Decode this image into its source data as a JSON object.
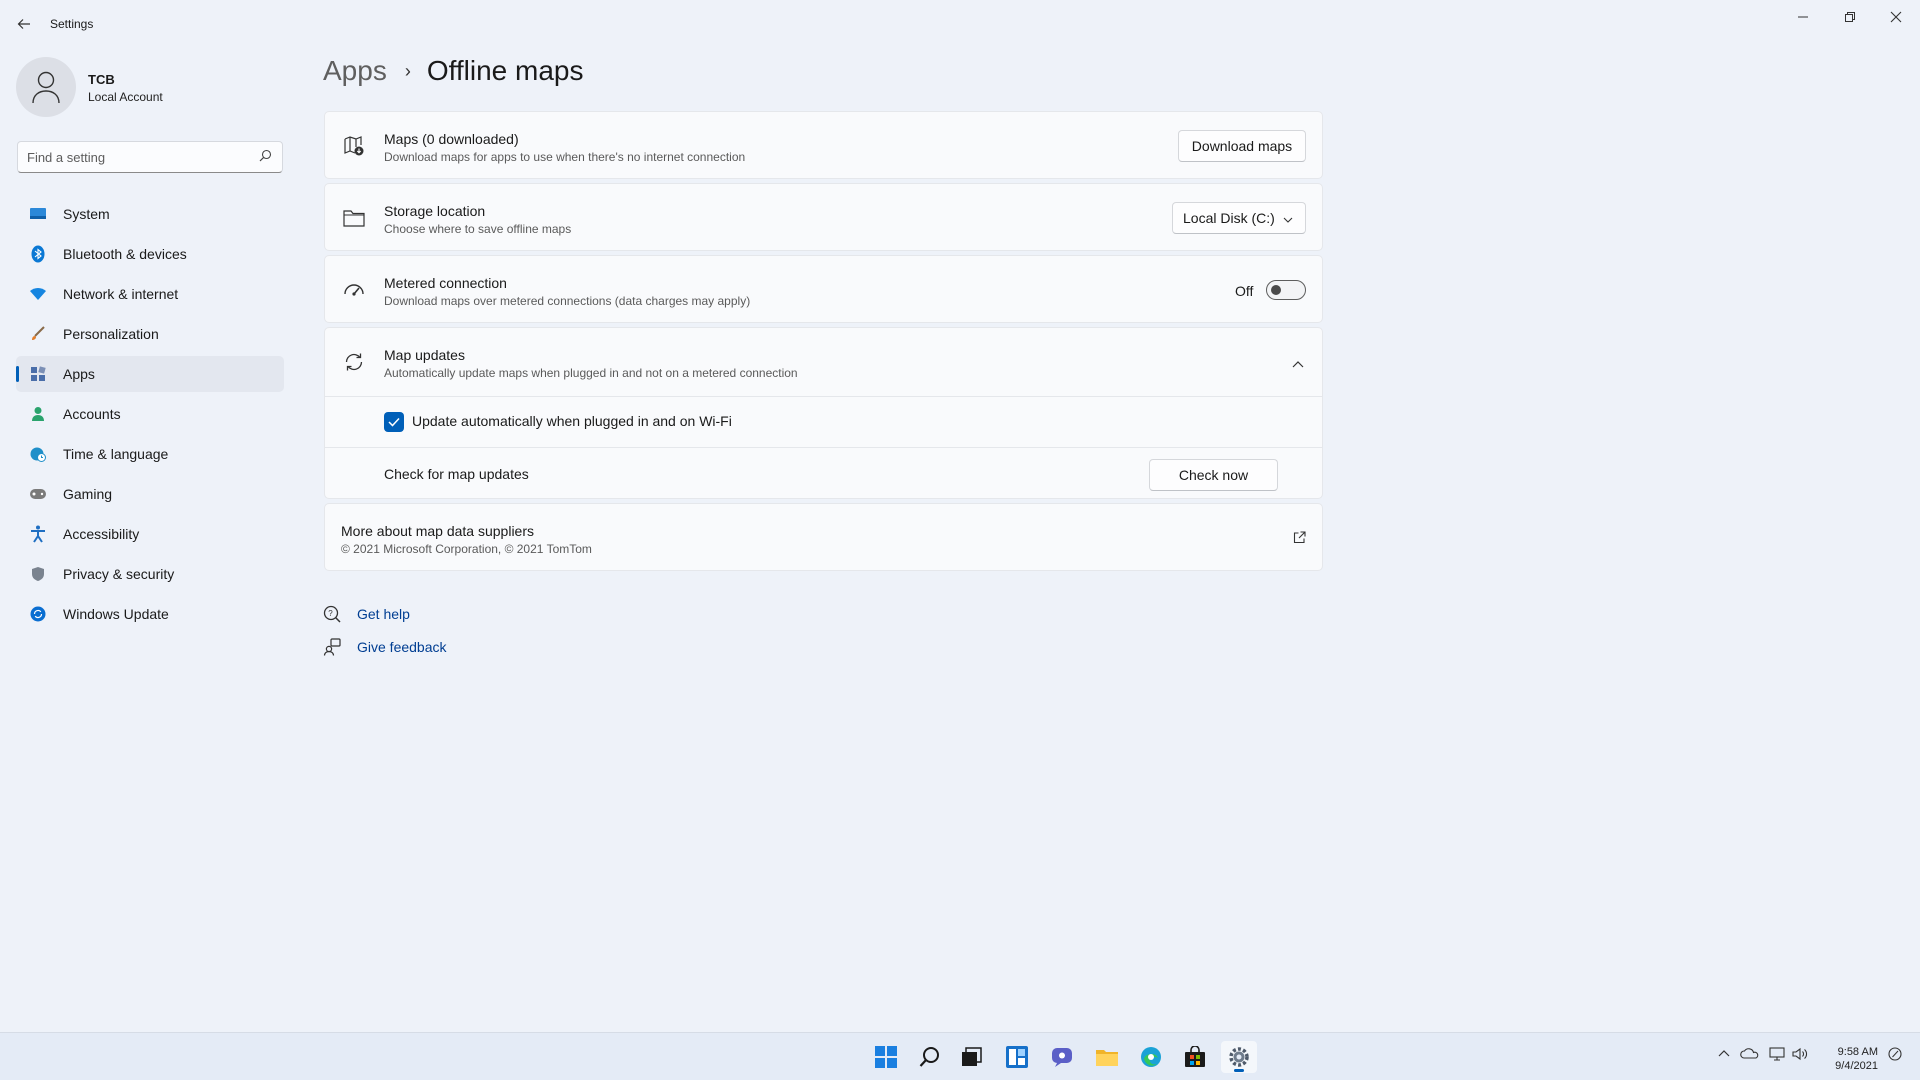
{
  "window": {
    "title": "Settings",
    "back_icon": "back-arrow-icon",
    "controls": [
      "minimize",
      "restore",
      "close"
    ]
  },
  "profile": {
    "name": "TCB",
    "account_type": "Local Account"
  },
  "search": {
    "placeholder": "Find a setting"
  },
  "sidebar": {
    "items": [
      {
        "label": "System",
        "icon": "system-icon",
        "color": "#0078d4"
      },
      {
        "label": "Bluetooth & devices",
        "icon": "bluetooth-icon",
        "color": "#0078d4"
      },
      {
        "label": "Network & internet",
        "icon": "wifi-icon",
        "color": "#0078d4"
      },
      {
        "label": "Personalization",
        "icon": "brush-icon",
        "color": "#e37e2b"
      },
      {
        "label": "Apps",
        "icon": "apps-icon",
        "color": "#4a6ea9"
      },
      {
        "label": "Accounts",
        "icon": "person-icon",
        "color": "#2aa36d"
      },
      {
        "label": "Time & language",
        "icon": "globe-clock-icon",
        "color": "#1f8fc9"
      },
      {
        "label": "Gaming",
        "icon": "gamepad-icon",
        "color": "#6b6b6b"
      },
      {
        "label": "Accessibility",
        "icon": "accessibility-icon",
        "color": "#1f6fc2"
      },
      {
        "label": "Privacy & security",
        "icon": "shield-icon",
        "color": "#707a86"
      },
      {
        "label": "Windows Update",
        "icon": "update-icon",
        "color": "#0a6ed1"
      }
    ],
    "active_index": 4
  },
  "breadcrumb": {
    "parent": "Apps",
    "separator": "›",
    "current": "Offline maps"
  },
  "cards": {
    "maps": {
      "title": "Maps (0 downloaded)",
      "subtitle": "Download maps for apps to use when there's no internet connection",
      "button": "Download maps"
    },
    "storage": {
      "title": "Storage location",
      "subtitle": "Choose where to save offline maps",
      "selected": "Local Disk (C:)"
    },
    "metered": {
      "title": "Metered connection",
      "subtitle": "Download maps over metered connections (data charges may apply)",
      "state_label": "Off",
      "enabled": false
    },
    "updates": {
      "title": "Map updates",
      "subtitle": "Automatically update maps when plugged in and not on a metered connection",
      "expanded": true,
      "auto_update_label": "Update automatically when plugged in and on Wi-Fi",
      "auto_update_checked": true,
      "check_label": "Check for map updates",
      "check_button": "Check now"
    },
    "suppliers": {
      "title": "More about map data suppliers",
      "subtitle": "© 2021 Microsoft Corporation, © 2021 TomTom"
    }
  },
  "help": {
    "get_help": "Get help",
    "give_feedback": "Give feedback"
  },
  "taskbar": {
    "pinned": [
      "start-icon",
      "search-icon",
      "task-view-icon",
      "widgets-icon",
      "chat-icon",
      "file-explorer-icon",
      "edge-icon",
      "store-icon",
      "settings-icon"
    ],
    "active": "settings-icon",
    "clock_time": "9:58 AM",
    "clock_date": "9/4/2021"
  },
  "colors": {
    "accent": "#005fb8",
    "background": "#eef2f9",
    "card": "#f9fafc"
  }
}
